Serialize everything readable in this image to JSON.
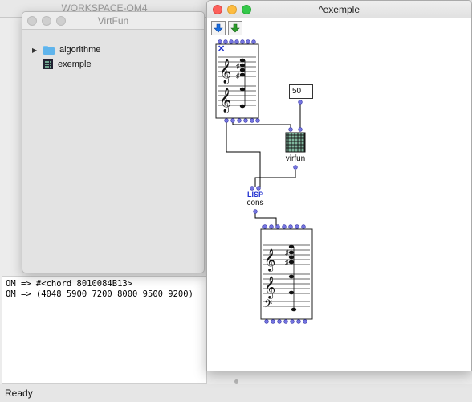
{
  "workspace": {
    "title": "WORKSPACE-OM4"
  },
  "virtfun_window": {
    "title": "VirtFun",
    "items": [
      {
        "label": "algorithme",
        "icon": "folder-icon"
      },
      {
        "label": "exemple",
        "icon": "patch-icon"
      }
    ]
  },
  "patch_window": {
    "title": "^exemple",
    "toolbar": [
      {
        "icon": "arrow-down-blue-icon"
      },
      {
        "icon": "arrow-down-green-icon"
      }
    ],
    "boxes": {
      "number_value": "50",
      "virfun_label": "virfun",
      "lisp_label": "LISP",
      "cons_label": "cons"
    }
  },
  "listener": {
    "lines": [
      "OM => #<chord 8010084B13>",
      "OM => (4048 5900 7200 8000 9500 9200)"
    ]
  },
  "status": {
    "text": "Ready"
  },
  "colors": {
    "inlet": "#6b6bd6",
    "connection": "#000000",
    "lisp_blue": "#1f2fd0"
  }
}
